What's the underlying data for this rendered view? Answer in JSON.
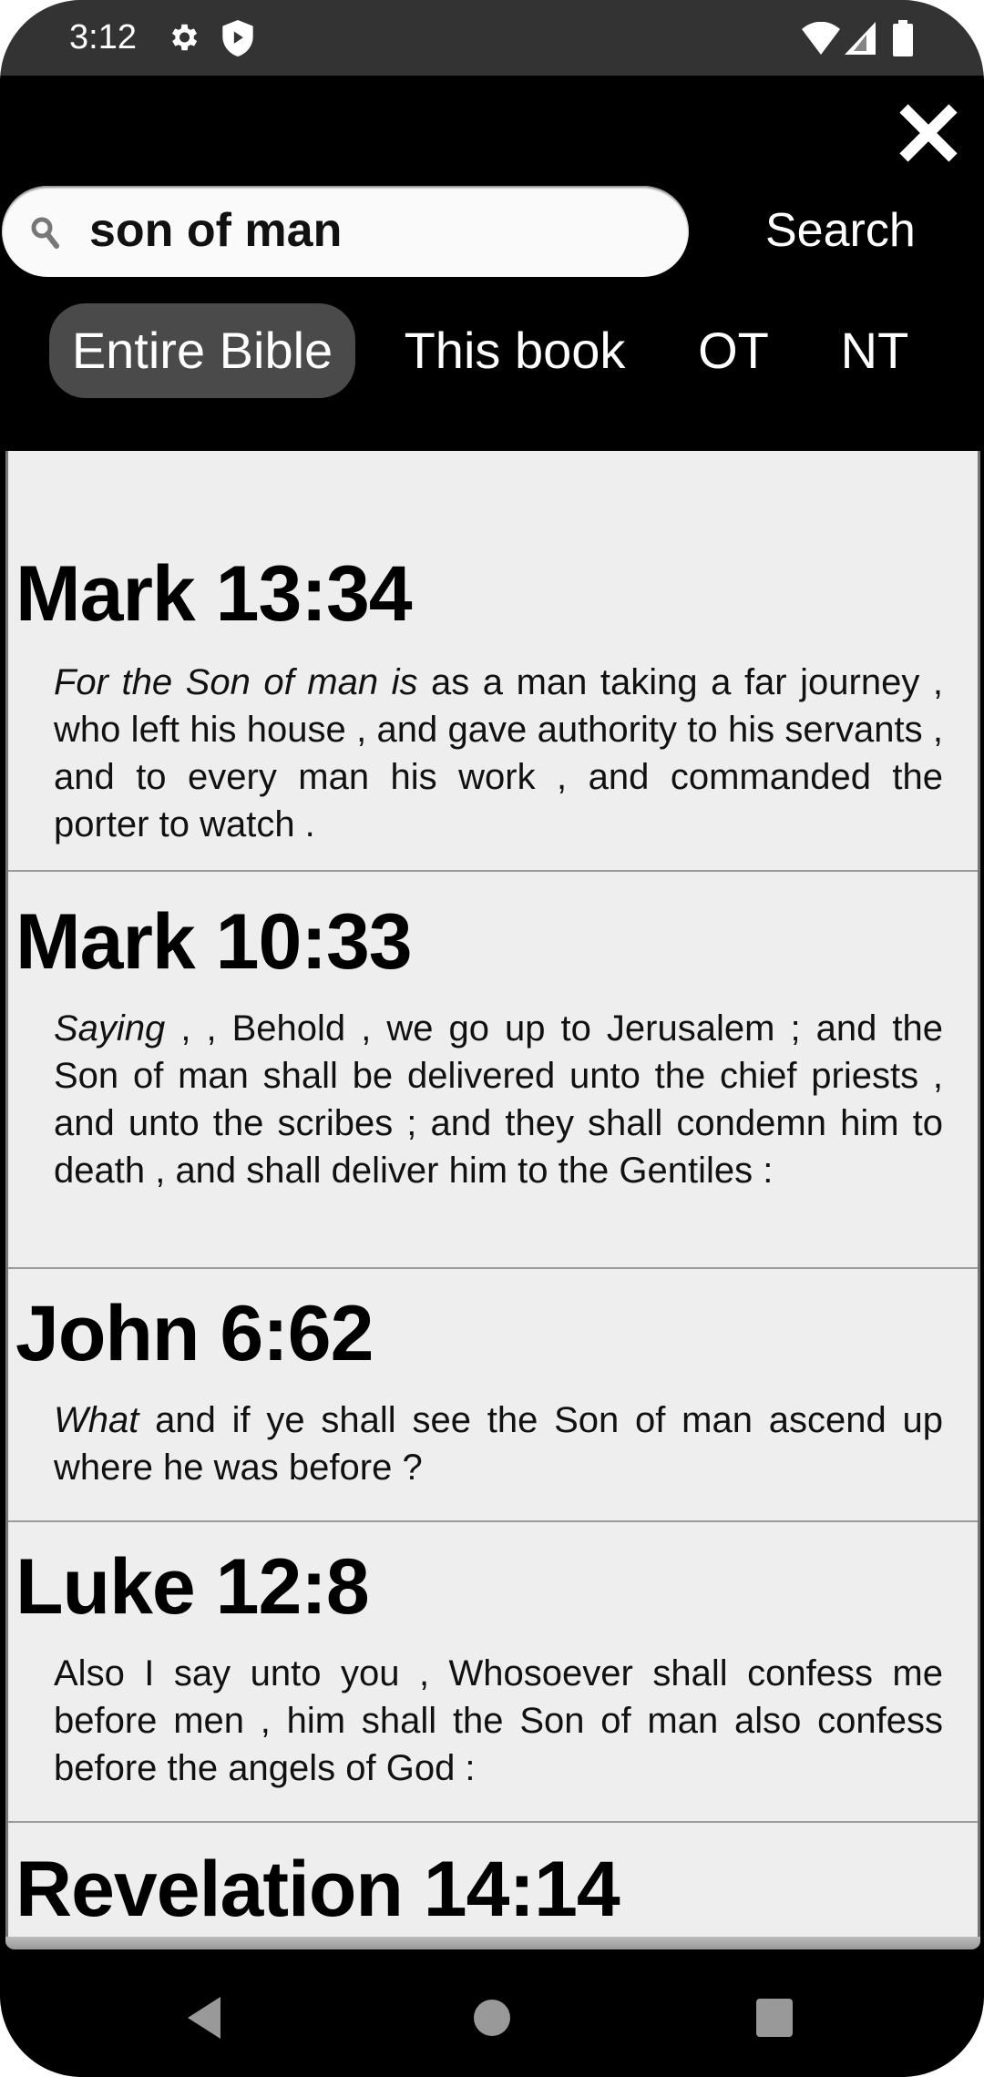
{
  "status_bar": {
    "time": "3:12",
    "left_icons": [
      "gear-icon",
      "shield-play-icon"
    ],
    "right_icons": [
      "wifi-icon",
      "signal-icon",
      "battery-icon"
    ]
  },
  "header": {
    "close_icon": "close-icon",
    "search": {
      "icon": "search-icon",
      "value": "son of man",
      "placeholder": ""
    },
    "search_button_label": "Search",
    "scopes": [
      {
        "label": "Entire Bible",
        "active": true
      },
      {
        "label": "This book",
        "active": false
      },
      {
        "label": "OT",
        "active": false
      },
      {
        "label": "NT",
        "active": false
      }
    ]
  },
  "results": [
    {
      "reference": "Mark 13:34",
      "italic_lead": "For the Son of man is",
      "text": " as a man taking a far journey , who left his house , and gave authority to his servants , and to every man his work , and commanded the porter to watch ."
    },
    {
      "reference": "Mark 10:33",
      "italic_lead": "Saying",
      "text": " , , Behold , we go up to Jerusalem ; and the Son of man shall be delivered unto the chief priests , and unto the scribes ; and they shall condemn him to death , and shall deliver him to the Gentiles :"
    },
    {
      "reference": "John 6:62",
      "italic_lead": "What",
      "text": " and if ye shall see the Son of man ascend up where he was before ?"
    },
    {
      "reference": "Luke 12:8",
      "italic_lead": "",
      "text": "Also I say unto you , Whosoever shall confess me before men , him shall the Son of man also confess before the angels of God :"
    },
    {
      "reference": "Revelation 14:14",
      "italic_lead": "",
      "text": ""
    }
  ],
  "nav_bar": {
    "icons": [
      "back-icon",
      "home-icon",
      "recents-icon"
    ]
  }
}
